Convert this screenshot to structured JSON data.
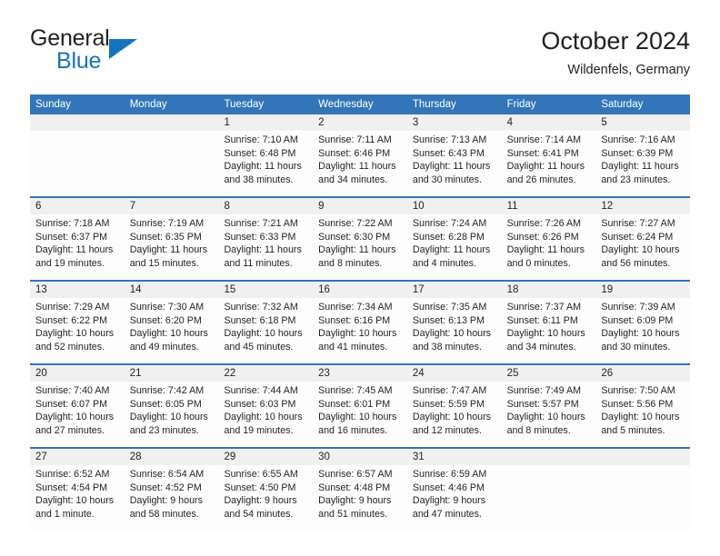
{
  "brand": {
    "word_general": "General",
    "word_blue": "Blue",
    "triangle_color": "#1473bb"
  },
  "header": {
    "month_title": "October 2024",
    "location": "Wildenfels, Germany",
    "header_bg_color": "#3275b8",
    "daynum_bg_color": "#f0f0f0"
  },
  "weekdays": [
    "Sunday",
    "Monday",
    "Tuesday",
    "Wednesday",
    "Thursday",
    "Friday",
    "Saturday"
  ],
  "weeks": [
    [
      {
        "day": "",
        "lines": []
      },
      {
        "day": "",
        "lines": []
      },
      {
        "day": "1",
        "lines": [
          "Sunrise: 7:10 AM",
          "Sunset: 6:48 PM",
          "Daylight: 11 hours",
          "and 38 minutes."
        ]
      },
      {
        "day": "2",
        "lines": [
          "Sunrise: 7:11 AM",
          "Sunset: 6:46 PM",
          "Daylight: 11 hours",
          "and 34 minutes."
        ]
      },
      {
        "day": "3",
        "lines": [
          "Sunrise: 7:13 AM",
          "Sunset: 6:43 PM",
          "Daylight: 11 hours",
          "and 30 minutes."
        ]
      },
      {
        "day": "4",
        "lines": [
          "Sunrise: 7:14 AM",
          "Sunset: 6:41 PM",
          "Daylight: 11 hours",
          "and 26 minutes."
        ]
      },
      {
        "day": "5",
        "lines": [
          "Sunrise: 7:16 AM",
          "Sunset: 6:39 PM",
          "Daylight: 11 hours",
          "and 23 minutes."
        ]
      }
    ],
    [
      {
        "day": "6",
        "lines": [
          "Sunrise: 7:18 AM",
          "Sunset: 6:37 PM",
          "Daylight: 11 hours",
          "and 19 minutes."
        ]
      },
      {
        "day": "7",
        "lines": [
          "Sunrise: 7:19 AM",
          "Sunset: 6:35 PM",
          "Daylight: 11 hours",
          "and 15 minutes."
        ]
      },
      {
        "day": "8",
        "lines": [
          "Sunrise: 7:21 AM",
          "Sunset: 6:33 PM",
          "Daylight: 11 hours",
          "and 11 minutes."
        ]
      },
      {
        "day": "9",
        "lines": [
          "Sunrise: 7:22 AM",
          "Sunset: 6:30 PM",
          "Daylight: 11 hours",
          "and 8 minutes."
        ]
      },
      {
        "day": "10",
        "lines": [
          "Sunrise: 7:24 AM",
          "Sunset: 6:28 PM",
          "Daylight: 11 hours",
          "and 4 minutes."
        ]
      },
      {
        "day": "11",
        "lines": [
          "Sunrise: 7:26 AM",
          "Sunset: 6:26 PM",
          "Daylight: 11 hours",
          "and 0 minutes."
        ]
      },
      {
        "day": "12",
        "lines": [
          "Sunrise: 7:27 AM",
          "Sunset: 6:24 PM",
          "Daylight: 10 hours",
          "and 56 minutes."
        ]
      }
    ],
    [
      {
        "day": "13",
        "lines": [
          "Sunrise: 7:29 AM",
          "Sunset: 6:22 PM",
          "Daylight: 10 hours",
          "and 52 minutes."
        ]
      },
      {
        "day": "14",
        "lines": [
          "Sunrise: 7:30 AM",
          "Sunset: 6:20 PM",
          "Daylight: 10 hours",
          "and 49 minutes."
        ]
      },
      {
        "day": "15",
        "lines": [
          "Sunrise: 7:32 AM",
          "Sunset: 6:18 PM",
          "Daylight: 10 hours",
          "and 45 minutes."
        ]
      },
      {
        "day": "16",
        "lines": [
          "Sunrise: 7:34 AM",
          "Sunset: 6:16 PM",
          "Daylight: 10 hours",
          "and 41 minutes."
        ]
      },
      {
        "day": "17",
        "lines": [
          "Sunrise: 7:35 AM",
          "Sunset: 6:13 PM",
          "Daylight: 10 hours",
          "and 38 minutes."
        ]
      },
      {
        "day": "18",
        "lines": [
          "Sunrise: 7:37 AM",
          "Sunset: 6:11 PM",
          "Daylight: 10 hours",
          "and 34 minutes."
        ]
      },
      {
        "day": "19",
        "lines": [
          "Sunrise: 7:39 AM",
          "Sunset: 6:09 PM",
          "Daylight: 10 hours",
          "and 30 minutes."
        ]
      }
    ],
    [
      {
        "day": "20",
        "lines": [
          "Sunrise: 7:40 AM",
          "Sunset: 6:07 PM",
          "Daylight: 10 hours",
          "and 27 minutes."
        ]
      },
      {
        "day": "21",
        "lines": [
          "Sunrise: 7:42 AM",
          "Sunset: 6:05 PM",
          "Daylight: 10 hours",
          "and 23 minutes."
        ]
      },
      {
        "day": "22",
        "lines": [
          "Sunrise: 7:44 AM",
          "Sunset: 6:03 PM",
          "Daylight: 10 hours",
          "and 19 minutes."
        ]
      },
      {
        "day": "23",
        "lines": [
          "Sunrise: 7:45 AM",
          "Sunset: 6:01 PM",
          "Daylight: 10 hours",
          "and 16 minutes."
        ]
      },
      {
        "day": "24",
        "lines": [
          "Sunrise: 7:47 AM",
          "Sunset: 5:59 PM",
          "Daylight: 10 hours",
          "and 12 minutes."
        ]
      },
      {
        "day": "25",
        "lines": [
          "Sunrise: 7:49 AM",
          "Sunset: 5:57 PM",
          "Daylight: 10 hours",
          "and 8 minutes."
        ]
      },
      {
        "day": "26",
        "lines": [
          "Sunrise: 7:50 AM",
          "Sunset: 5:56 PM",
          "Daylight: 10 hours",
          "and 5 minutes."
        ]
      }
    ],
    [
      {
        "day": "27",
        "lines": [
          "Sunrise: 6:52 AM",
          "Sunset: 4:54 PM",
          "Daylight: 10 hours",
          "and 1 minute."
        ]
      },
      {
        "day": "28",
        "lines": [
          "Sunrise: 6:54 AM",
          "Sunset: 4:52 PM",
          "Daylight: 9 hours",
          "and 58 minutes."
        ]
      },
      {
        "day": "29",
        "lines": [
          "Sunrise: 6:55 AM",
          "Sunset: 4:50 PM",
          "Daylight: 9 hours",
          "and 54 minutes."
        ]
      },
      {
        "day": "30",
        "lines": [
          "Sunrise: 6:57 AM",
          "Sunset: 4:48 PM",
          "Daylight: 9 hours",
          "and 51 minutes."
        ]
      },
      {
        "day": "31",
        "lines": [
          "Sunrise: 6:59 AM",
          "Sunset: 4:46 PM",
          "Daylight: 9 hours",
          "and 47 minutes."
        ]
      },
      {
        "day": "",
        "lines": []
      },
      {
        "day": "",
        "lines": []
      }
    ]
  ]
}
